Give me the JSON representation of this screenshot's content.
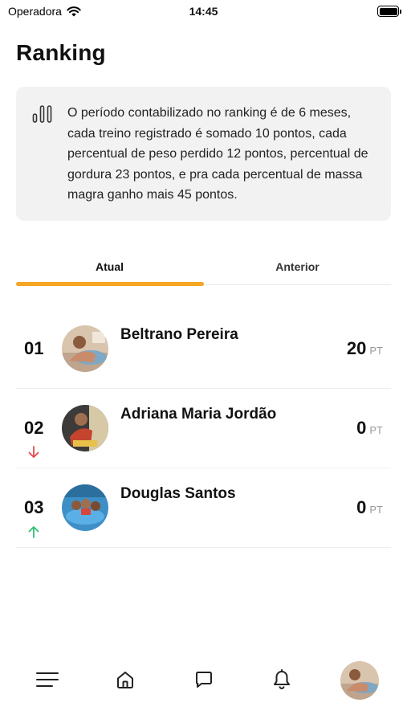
{
  "status_bar": {
    "carrier": "Operadora",
    "time": "14:45"
  },
  "page": {
    "title": "Ranking"
  },
  "info": {
    "icon": "bar-chart-icon",
    "text": "O período contabilizado no ranking é de 6 meses, cada treino registrado é somado 10 pontos, cada percentual de peso perdido 12 pontos, percentual de gordura 23 pontos, e pra cada percentual de massa magra ganho mais 45 pontos."
  },
  "tabs": {
    "current": "Atual",
    "previous": "Anterior",
    "active": "current"
  },
  "ranking": [
    {
      "position": "01",
      "name": "Beltrano Pereira",
      "points": "20",
      "unit": "PT",
      "trend": "none"
    },
    {
      "position": "02",
      "name": "Adriana Maria Jordão",
      "points": "0",
      "unit": "PT",
      "trend": "down"
    },
    {
      "position": "03",
      "name": "Douglas Santos",
      "points": "0",
      "unit": "PT",
      "trend": "up"
    }
  ],
  "colors": {
    "accent": "#f5a623",
    "trend_down": "#e5484d",
    "trend_up": "#2fbf71"
  },
  "bottom_nav": {
    "items": [
      "menu-icon",
      "home-icon",
      "chat-icon",
      "bell-icon",
      "profile-avatar"
    ]
  }
}
